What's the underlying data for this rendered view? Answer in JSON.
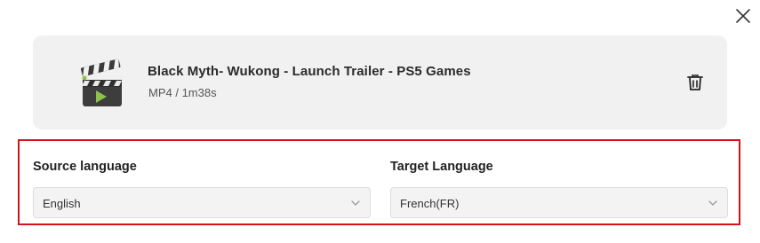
{
  "dialog": {
    "close_icon": "close-icon"
  },
  "file": {
    "title": "Black Myth- Wukong - Launch Trailer - PS5 Games",
    "meta": "MP4 / 1m38s",
    "thumbnail_icon": "clapperboard-icon",
    "delete_icon": "trash-icon"
  },
  "languages": {
    "source_label": "Source language",
    "source_value": "English",
    "target_label": "Target Language",
    "target_value": "French(FR)",
    "highlight_color": "#d0121b"
  }
}
